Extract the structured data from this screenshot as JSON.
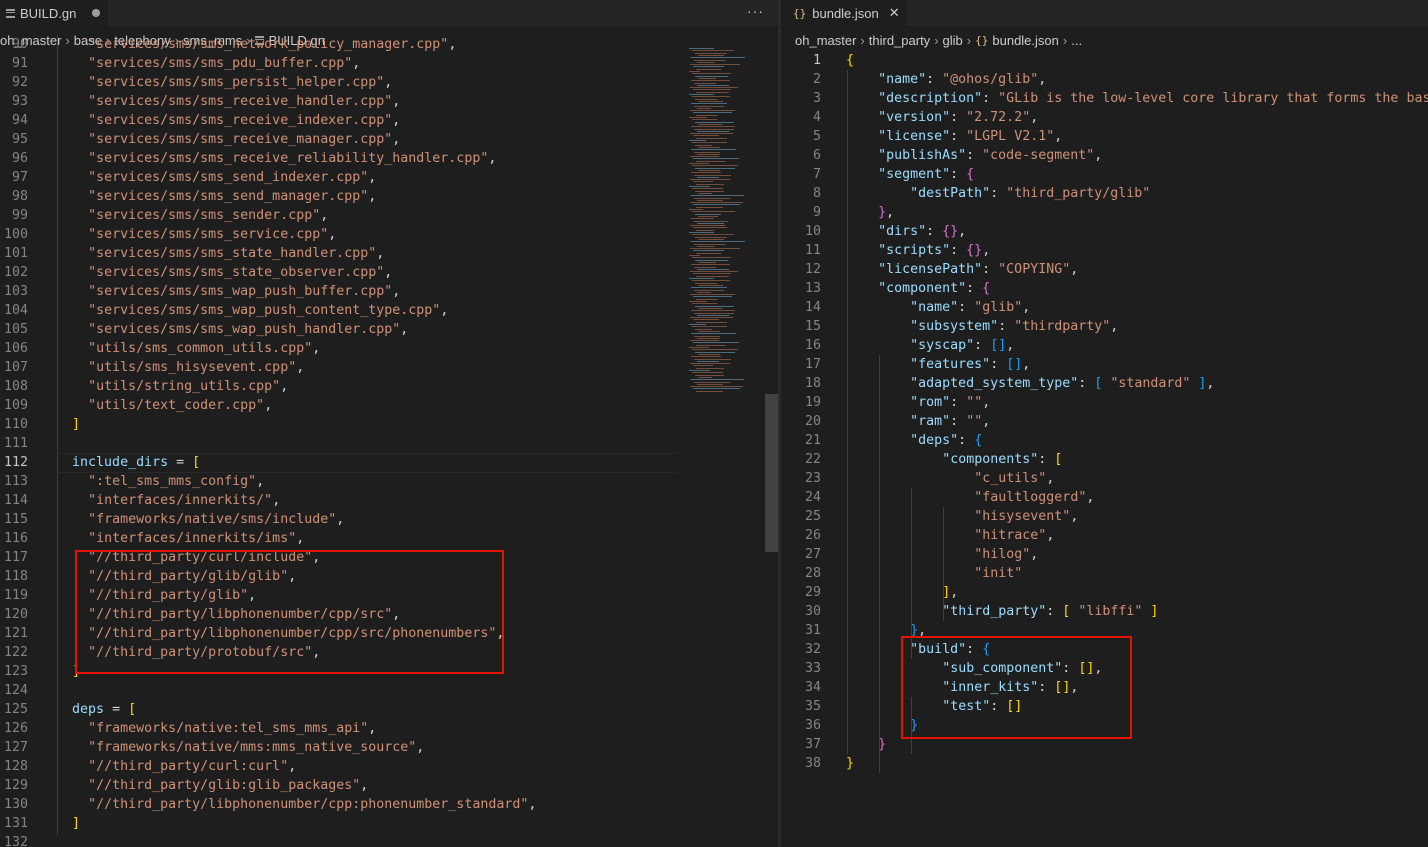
{
  "left_editor": {
    "tab": {
      "label": "BUILD.gn",
      "icon": "gn-file-icon"
    },
    "more_label": "···",
    "breadcrumbs": [
      "oh_master",
      "base",
      "telephony",
      "sms_mms",
      "BUILD.gn"
    ],
    "active_line": "112",
    "lines": [
      {
        "n": "90",
        "text": "    \"services/sms/sms_network_policy_manager.cpp\","
      },
      {
        "n": "91",
        "text": "    \"services/sms/sms_pdu_buffer.cpp\","
      },
      {
        "n": "92",
        "text": "    \"services/sms/sms_persist_helper.cpp\","
      },
      {
        "n": "93",
        "text": "    \"services/sms/sms_receive_handler.cpp\","
      },
      {
        "n": "94",
        "text": "    \"services/sms/sms_receive_indexer.cpp\","
      },
      {
        "n": "95",
        "text": "    \"services/sms/sms_receive_manager.cpp\","
      },
      {
        "n": "96",
        "text": "    \"services/sms/sms_receive_reliability_handler.cpp\","
      },
      {
        "n": "97",
        "text": "    \"services/sms/sms_send_indexer.cpp\","
      },
      {
        "n": "98",
        "text": "    \"services/sms/sms_send_manager.cpp\","
      },
      {
        "n": "99",
        "text": "    \"services/sms/sms_sender.cpp\","
      },
      {
        "n": "100",
        "text": "    \"services/sms/sms_service.cpp\","
      },
      {
        "n": "101",
        "text": "    \"services/sms/sms_state_handler.cpp\","
      },
      {
        "n": "102",
        "text": "    \"services/sms/sms_state_observer.cpp\","
      },
      {
        "n": "103",
        "text": "    \"services/sms/sms_wap_push_buffer.cpp\","
      },
      {
        "n": "104",
        "text": "    \"services/sms/sms_wap_push_content_type.cpp\","
      },
      {
        "n": "105",
        "text": "    \"services/sms/sms_wap_push_handler.cpp\","
      },
      {
        "n": "106",
        "text": "    \"utils/sms_common_utils.cpp\","
      },
      {
        "n": "107",
        "text": "    \"utils/sms_hisysevent.cpp\","
      },
      {
        "n": "108",
        "text": "    \"utils/string_utils.cpp\","
      },
      {
        "n": "109",
        "text": "    \"utils/text_coder.cpp\","
      },
      {
        "n": "110",
        "text": "  ]"
      },
      {
        "n": "111",
        "text": ""
      },
      {
        "n": "112",
        "text": "  include_dirs = ["
      },
      {
        "n": "113",
        "text": "    \":tel_sms_mms_config\","
      },
      {
        "n": "114",
        "text": "    \"interfaces/innerkits/\","
      },
      {
        "n": "115",
        "text": "    \"frameworks/native/sms/include\","
      },
      {
        "n": "116",
        "text": "    \"interfaces/innerkits/ims\","
      },
      {
        "n": "117",
        "text": "    \"//third_party/curl/include\","
      },
      {
        "n": "118",
        "text": "    \"//third_party/glib/glib\","
      },
      {
        "n": "119",
        "text": "    \"//third_party/glib\","
      },
      {
        "n": "120",
        "text": "    \"//third_party/libphonenumber/cpp/src\","
      },
      {
        "n": "121",
        "text": "    \"//third_party/libphonenumber/cpp/src/phonenumbers\","
      },
      {
        "n": "122",
        "text": "    \"//third_party/protobuf/src\","
      },
      {
        "n": "123",
        "text": "  ]"
      },
      {
        "n": "124",
        "text": ""
      },
      {
        "n": "125",
        "text": "  deps = ["
      },
      {
        "n": "126",
        "text": "    \"frameworks/native:tel_sms_mms_api\","
      },
      {
        "n": "127",
        "text": "    \"frameworks/native/mms:mms_native_source\","
      },
      {
        "n": "128",
        "text": "    \"//third_party/curl:curl\","
      },
      {
        "n": "129",
        "text": "    \"//third_party/glib:glib_packages\","
      },
      {
        "n": "130",
        "text": "    \"//third_party/libphonenumber/cpp:phonenumber_standard\","
      },
      {
        "n": "131",
        "text": "  ]"
      },
      {
        "n": "132",
        "text": ""
      }
    ]
  },
  "right_editor": {
    "tab": {
      "label": "bundle.json",
      "icon": "json-braces-icon"
    },
    "tab_close": "✕",
    "breadcrumbs": [
      "oh_master",
      "third_party",
      "glib",
      "bundle.json",
      "..."
    ],
    "active_line": "1",
    "lines": [
      {
        "n": "1",
        "text": "{"
      },
      {
        "n": "2",
        "text": "    \"name\": \"@ohos/glib\","
      },
      {
        "n": "3",
        "text": "    \"description\": \"GLib is the low-level core library that forms the basis"
      },
      {
        "n": "4",
        "text": "    \"version\": \"2.72.2\","
      },
      {
        "n": "5",
        "text": "    \"license\": \"LGPL V2.1\","
      },
      {
        "n": "6",
        "text": "    \"publishAs\": \"code-segment\","
      },
      {
        "n": "7",
        "text": "    \"segment\": {"
      },
      {
        "n": "8",
        "text": "        \"destPath\": \"third_party/glib\""
      },
      {
        "n": "9",
        "text": "    },"
      },
      {
        "n": "10",
        "text": "    \"dirs\": {},"
      },
      {
        "n": "11",
        "text": "    \"scripts\": {},"
      },
      {
        "n": "12",
        "text": "    \"licensePath\": \"COPYING\","
      },
      {
        "n": "13",
        "text": "    \"component\": {"
      },
      {
        "n": "14",
        "text": "        \"name\": \"glib\","
      },
      {
        "n": "15",
        "text": "        \"subsystem\": \"thirdparty\","
      },
      {
        "n": "16",
        "text": "        \"syscap\": [],"
      },
      {
        "n": "17",
        "text": "        \"features\": [],"
      },
      {
        "n": "18",
        "text": "        \"adapted_system_type\": [ \"standard\" ],"
      },
      {
        "n": "19",
        "text": "        \"rom\": \"\","
      },
      {
        "n": "20",
        "text": "        \"ram\": \"\","
      },
      {
        "n": "21",
        "text": "        \"deps\": {"
      },
      {
        "n": "22",
        "text": "            \"components\": ["
      },
      {
        "n": "23",
        "text": "                \"c_utils\","
      },
      {
        "n": "24",
        "text": "                \"faultloggerd\","
      },
      {
        "n": "25",
        "text": "                \"hisysevent\","
      },
      {
        "n": "26",
        "text": "                \"hitrace\","
      },
      {
        "n": "27",
        "text": "                \"hilog\","
      },
      {
        "n": "28",
        "text": "                \"init\""
      },
      {
        "n": "29",
        "text": "            ],"
      },
      {
        "n": "30",
        "text": "            \"third_party\": [ \"libffi\" ]"
      },
      {
        "n": "31",
        "text": "        },"
      },
      {
        "n": "32",
        "text": "        \"build\": {"
      },
      {
        "n": "33",
        "text": "            \"sub_component\": [],"
      },
      {
        "n": "34",
        "text": "            \"inner_kits\": [],"
      },
      {
        "n": "35",
        "text": "            \"test\": []"
      },
      {
        "n": "36",
        "text": "        }"
      },
      {
        "n": "37",
        "text": "    }"
      },
      {
        "n": "38",
        "text": "}"
      }
    ]
  },
  "colors": {
    "background": "#1e1e1e",
    "string": "#ce9178",
    "key": "#9cdcfe",
    "line_number": "#858585",
    "highlight_box": "#e51400",
    "json_icon": "#e2c08d"
  }
}
